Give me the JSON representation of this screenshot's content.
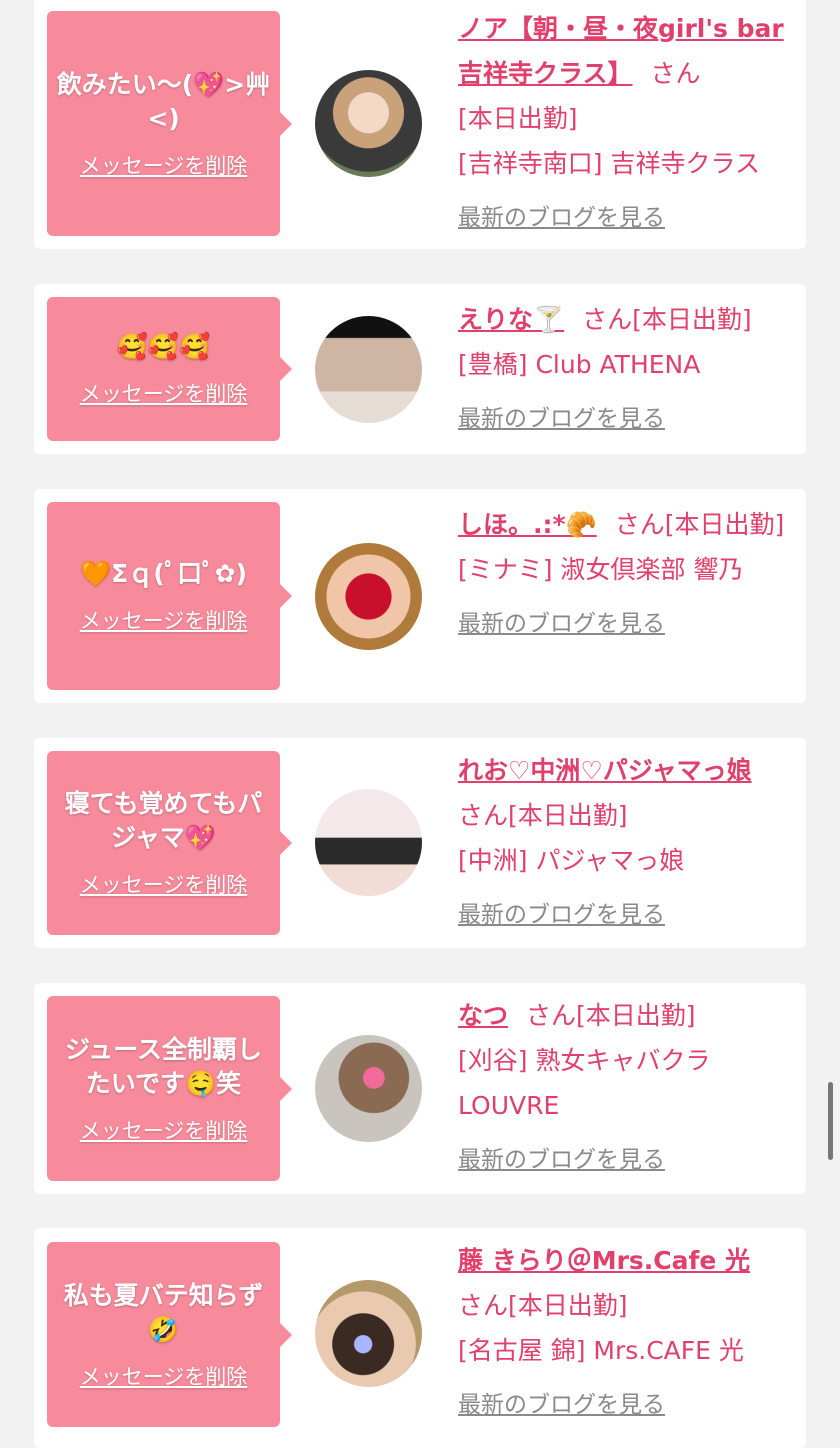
{
  "delete_label": "メッセージを削除",
  "blog_label": "最新のブログを見る",
  "san_label": "さん",
  "status_label": "[本日出勤]",
  "colors": {
    "accent": "#e0406b",
    "bubble": "#f78b9c",
    "background": "#f2f2f2"
  },
  "cards": [
    {
      "message": "飲みたい〜(💖>艸<)",
      "name": "ノア【朝・昼・夜girl's bar吉祥寺クラス】",
      "location": "[吉祥寺南口] 吉祥寺クラス"
    },
    {
      "message": "🥰🥰🥰",
      "name": "えりな🍸",
      "location": "[豊橋] Club ATHENA"
    },
    {
      "message": "🧡Σｑ(ﾟ口ﾟ✿)",
      "name": "しほ。.:*🥐",
      "location": "[ミナミ] 淑女倶楽部 響乃"
    },
    {
      "message": "寝ても覚めてもパジャマ💖",
      "name": "れお♡中洲♡パジャマっ娘",
      "location": "[中洲] パジャマっ娘"
    },
    {
      "message": "ジュース全制覇したいです🤤笑",
      "name": "なつ",
      "location": "[刈谷] 熟女キャバクラLOUVRE"
    },
    {
      "message": "私も夏バテ知らず🤣",
      "name": "藤 きらり＠Mrs.Cafe 光",
      "location": "[名古屋 錦] Mrs.CAFE 光"
    }
  ]
}
